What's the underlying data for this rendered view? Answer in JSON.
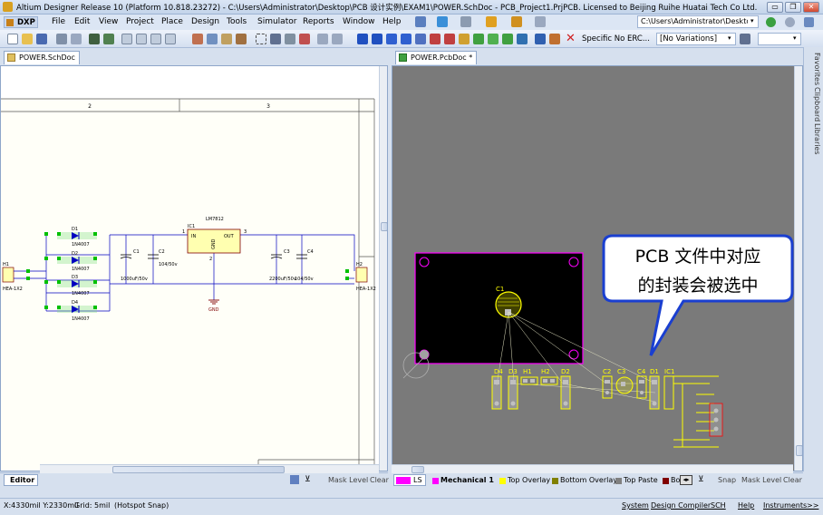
{
  "titlebar": {
    "text": "Altium Designer Release 10 (Platform 10.818.23272) - C:\\Users\\Administrator\\Desktop\\PCB 设计实例\\EXAM1\\POWER.SchDoc - PCB_Project1.PrjPCB. Licensed to Beijing Ruihe Huatai Tech Co Ltd. 刘中 ...",
    "minimize": "▭",
    "restore": "❐",
    "close": "✕"
  },
  "menu": {
    "dxp": "DXP",
    "items": [
      "File",
      "Edit",
      "View",
      "Project",
      "Place",
      "Design",
      "Tools",
      "Simulator",
      "Reports",
      "Window",
      "Help"
    ],
    "path_box": "C:\\Users\\Administrator\\Desktop"
  },
  "toolbar": {
    "specific_no_erc": "Specific No ERC...",
    "variations": "[No Variations]"
  },
  "tabs": {
    "left": "POWER.SchDoc",
    "right": "POWER.PcbDoc *"
  },
  "dock_tabs": [
    "Favorites",
    "Clipboard",
    "Libraries"
  ],
  "schematic": {
    "zone_labels": [
      "2",
      "3"
    ],
    "ic_ref": "IC1",
    "ic_name": "LM7812",
    "ic_pins": [
      "IN",
      "OUT",
      "GND"
    ],
    "pin_numbers": [
      "1",
      "3",
      "2"
    ],
    "diodes": [
      "D1",
      "D2",
      "D3",
      "D4"
    ],
    "diode_value": "1N4007",
    "caps": [
      "C1",
      "C2",
      "C3",
      "C4"
    ],
    "cap_values": [
      "1000uF/50v",
      "104/50v",
      "2200uF/50v",
      "104/50v"
    ],
    "h1": "H1",
    "h2": "H2",
    "h_value": "HEA-1X2",
    "gnd": "GND"
  },
  "pcb": {
    "components": [
      "D4",
      "D3",
      "H1",
      "H2",
      "D2",
      "C2",
      "C3",
      "C4",
      "D1",
      "IC1"
    ],
    "c1": "C1"
  },
  "callout": {
    "line1": "PCB 文件中对应",
    "line2": "的封装会被选中"
  },
  "left_bottom": {
    "editor_tab": "Editor",
    "mask_level": "Mask Level",
    "clear": "Clear"
  },
  "layers": {
    "ls": "LS",
    "items": [
      {
        "name": "Mechanical 1",
        "color": "#ff00ff"
      },
      {
        "name": "Top Overlay",
        "color": "#ffff00"
      },
      {
        "name": "Bottom Overlay",
        "color": "#808000"
      },
      {
        "name": "Top Paste",
        "color": "#808080"
      },
      {
        "name": "Bo",
        "color": "#800000"
      }
    ],
    "snap": "Snap",
    "mask_level": "Mask Level",
    "clear": "Clear"
  },
  "status": {
    "coords": "X:4330mil Y:2330mil",
    "grid": "Grid: 5mil",
    "hotspot": "(Hotspot Snap)",
    "buttons": [
      "System",
      "Design Compiler",
      "SCH",
      "Help",
      "Instruments",
      ">>"
    ]
  },
  "colors": {
    "pcb_board": "#000000",
    "pcb_outline": "#ff00ff",
    "overlay": "#ffff00",
    "pad": "#c0c0c0",
    "ratsnest": "#e0e0c0",
    "sch_wire": "#0000c0",
    "sch_component": "#800000",
    "sch_body": "#ffffb0",
    "callout_fill": "#ffffff",
    "callout_border": "#1a3fd0"
  }
}
